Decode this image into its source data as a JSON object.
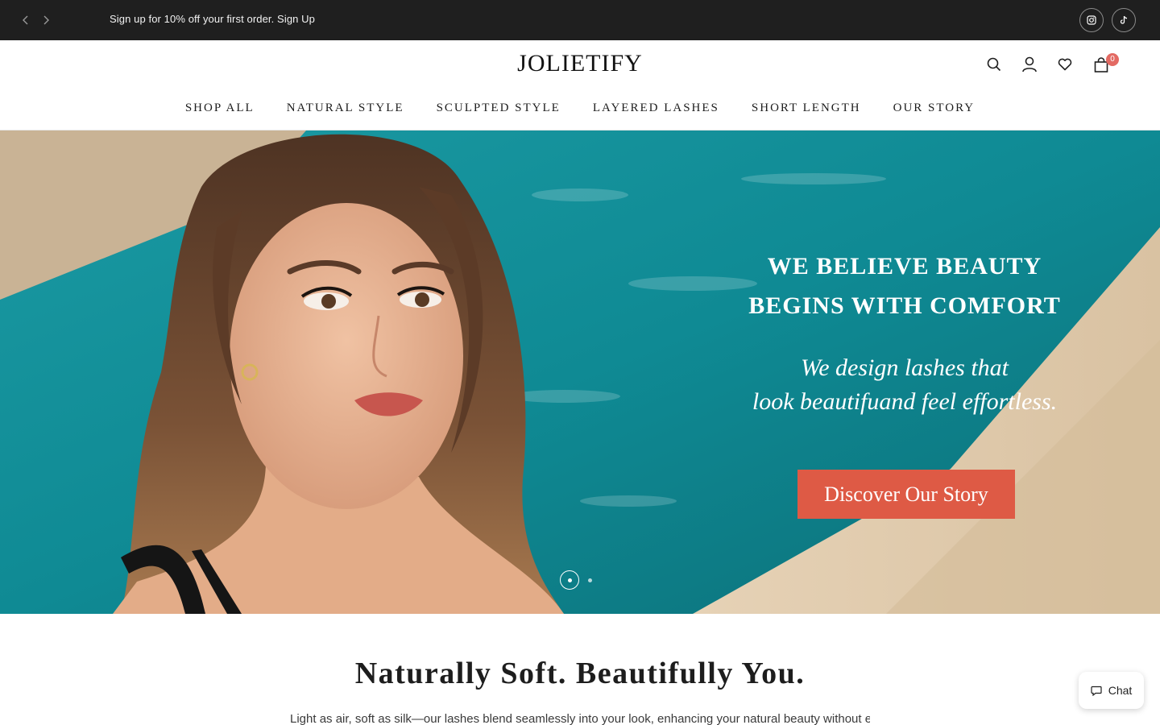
{
  "announcement": {
    "message": "Sign up for 10% off your first order. Sign Up",
    "prev_icon": "chevron-left-icon",
    "next_icon": "chevron-right-icon",
    "social": [
      "instagram-icon",
      "tiktok-icon"
    ]
  },
  "header": {
    "logo": "JOLIETIFY",
    "cart_count": "0",
    "icons": [
      "search-icon",
      "account-icon",
      "heart-icon",
      "bag-icon"
    ],
    "nav": [
      {
        "label": "SHOP ALL"
      },
      {
        "label": "NATURAL STYLE"
      },
      {
        "label": "SCULPTED STYLE"
      },
      {
        "label": "LAYERED LASHES"
      },
      {
        "label": "SHORT LENGTH"
      },
      {
        "label": "OUR STORY"
      }
    ]
  },
  "hero": {
    "headline_line1": "WE BELIEVE BEAUTY",
    "headline_line2": "BEGINS WITH COMFORT",
    "sub_line1": "We design lashes that",
    "sub_line2": "look beautifuand feel effortless.",
    "cta": "Discover Our Story",
    "slides_total": 2,
    "active_slide": 1
  },
  "intro": {
    "title": "Naturally Soft. Beautifully You.",
    "text": "Light as air, soft as silk—our lashes blend seamlessly into your look, enhancing your natural beauty without ever"
  },
  "chat": {
    "label": "Chat",
    "icon": "chat-bubble-icon"
  },
  "colors": {
    "topbar": "#1f1f1f",
    "accent": "#de5a45",
    "cart_badge": "#e36a63",
    "pool": "#0f8a94"
  }
}
